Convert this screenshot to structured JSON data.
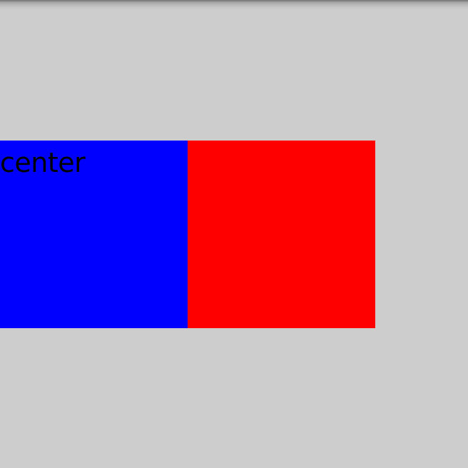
{
  "colors": {
    "background": "#cdcdcd",
    "box_left": "#0000ff",
    "box_right": "#ff0000",
    "text": "#000000"
  },
  "box_left": {
    "label": "center"
  }
}
